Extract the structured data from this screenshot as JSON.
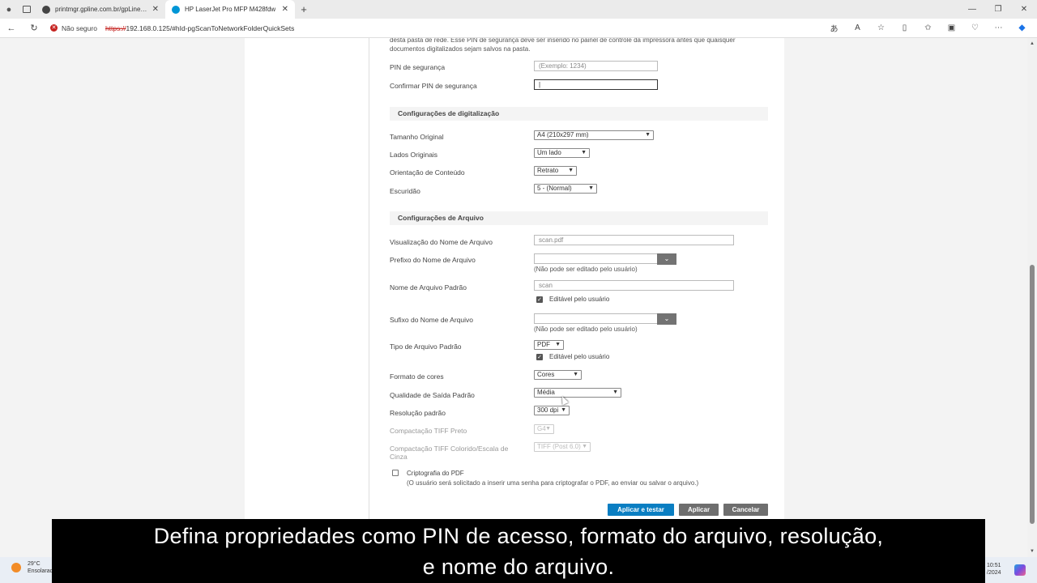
{
  "browser": {
    "tabs": [
      {
        "title": "printmgr.gpline.com.br/gpLineW...",
        "active": false
      },
      {
        "title": "HP LaserJet Pro MFP M428fdw",
        "active": true
      }
    ],
    "security_label": "Não seguro",
    "url_scheme": "https://",
    "url_rest": "192.168.0.125/#hId-pgScanToNetworkFolderQuickSets"
  },
  "page": {
    "intro_text": "desta pasta de rede. Esse PIN de segurança deve ser inserido no painel de controle da impressora antes que quaisquer documentos digitalizados sejam salvos na pasta.",
    "pin_label": "PIN de segurança",
    "pin_placeholder": "(Exemplo: 1234)",
    "confirm_pin_label": "Confirmar PIN de segurança",
    "confirm_pin_value": "|",
    "scan_section": "Configurações de digitalização",
    "original_size_label": "Tamanho Original",
    "original_size_value": "A4 (210x297 mm)",
    "original_sides_label": "Lados Originais",
    "original_sides_value": "Um lado",
    "orientation_label": "Orientação de Conteúdo",
    "orientation_value": "Retrato",
    "darkness_label": "Escuridão",
    "darkness_value": "5 - (Normal)",
    "file_section": "Configurações de Arquivo",
    "filename_preview_label": "Visualização do Nome de Arquivo",
    "filename_preview_value": "scan.pdf",
    "prefix_label": "Prefixo do Nome de Arquivo",
    "prefix_hint": "(Não pode ser editado pelo usuário)",
    "default_name_label": "Nome de Arquivo Padrão",
    "default_name_value": "scan",
    "editable_label": "Editável pelo usuário",
    "suffix_label": "Sufixo do Nome de Arquivo",
    "suffix_hint": "(Não pode ser editado pelo usuário)",
    "file_type_label": "Tipo de Arquivo Padrão",
    "file_type_value": "PDF",
    "file_type_editable_label": "Editável pelo usuário",
    "color_format_label": "Formato de cores",
    "color_format_value": "Cores",
    "output_quality_label": "Qualidade de Saída Padrão",
    "output_quality_value": "Média",
    "resolution_label": "Resolução padrão",
    "resolution_value": "300 dpi",
    "tiff_bw_label": "Compactação TIFF Preto",
    "tiff_bw_value": "G4",
    "tiff_color_label_1": "Compactação TIFF Colorido/Escala de",
    "tiff_color_label_2": "Cinza",
    "tiff_color_value": "TIFF (Post 6.0)",
    "pdf_encrypt_label": "Criptografia do PDF",
    "pdf_encrypt_hint": "(O usuário será solicitado a inserir uma senha para criptografar o PDF, ao enviar ou salvar o arquivo.)",
    "apply_test_button": "Aplicar e testar",
    "apply_button": "Aplicar",
    "cancel_button": "Cancelar"
  },
  "caption": {
    "line1": "Defina propriedades como PIN de acesso, formato do arquivo, resolução,",
    "line2": "e nome do arquivo."
  },
  "taskbar": {
    "temperature": "29°C",
    "weather": "Ensolarado",
    "time": "10:51",
    "date": "/2024"
  }
}
